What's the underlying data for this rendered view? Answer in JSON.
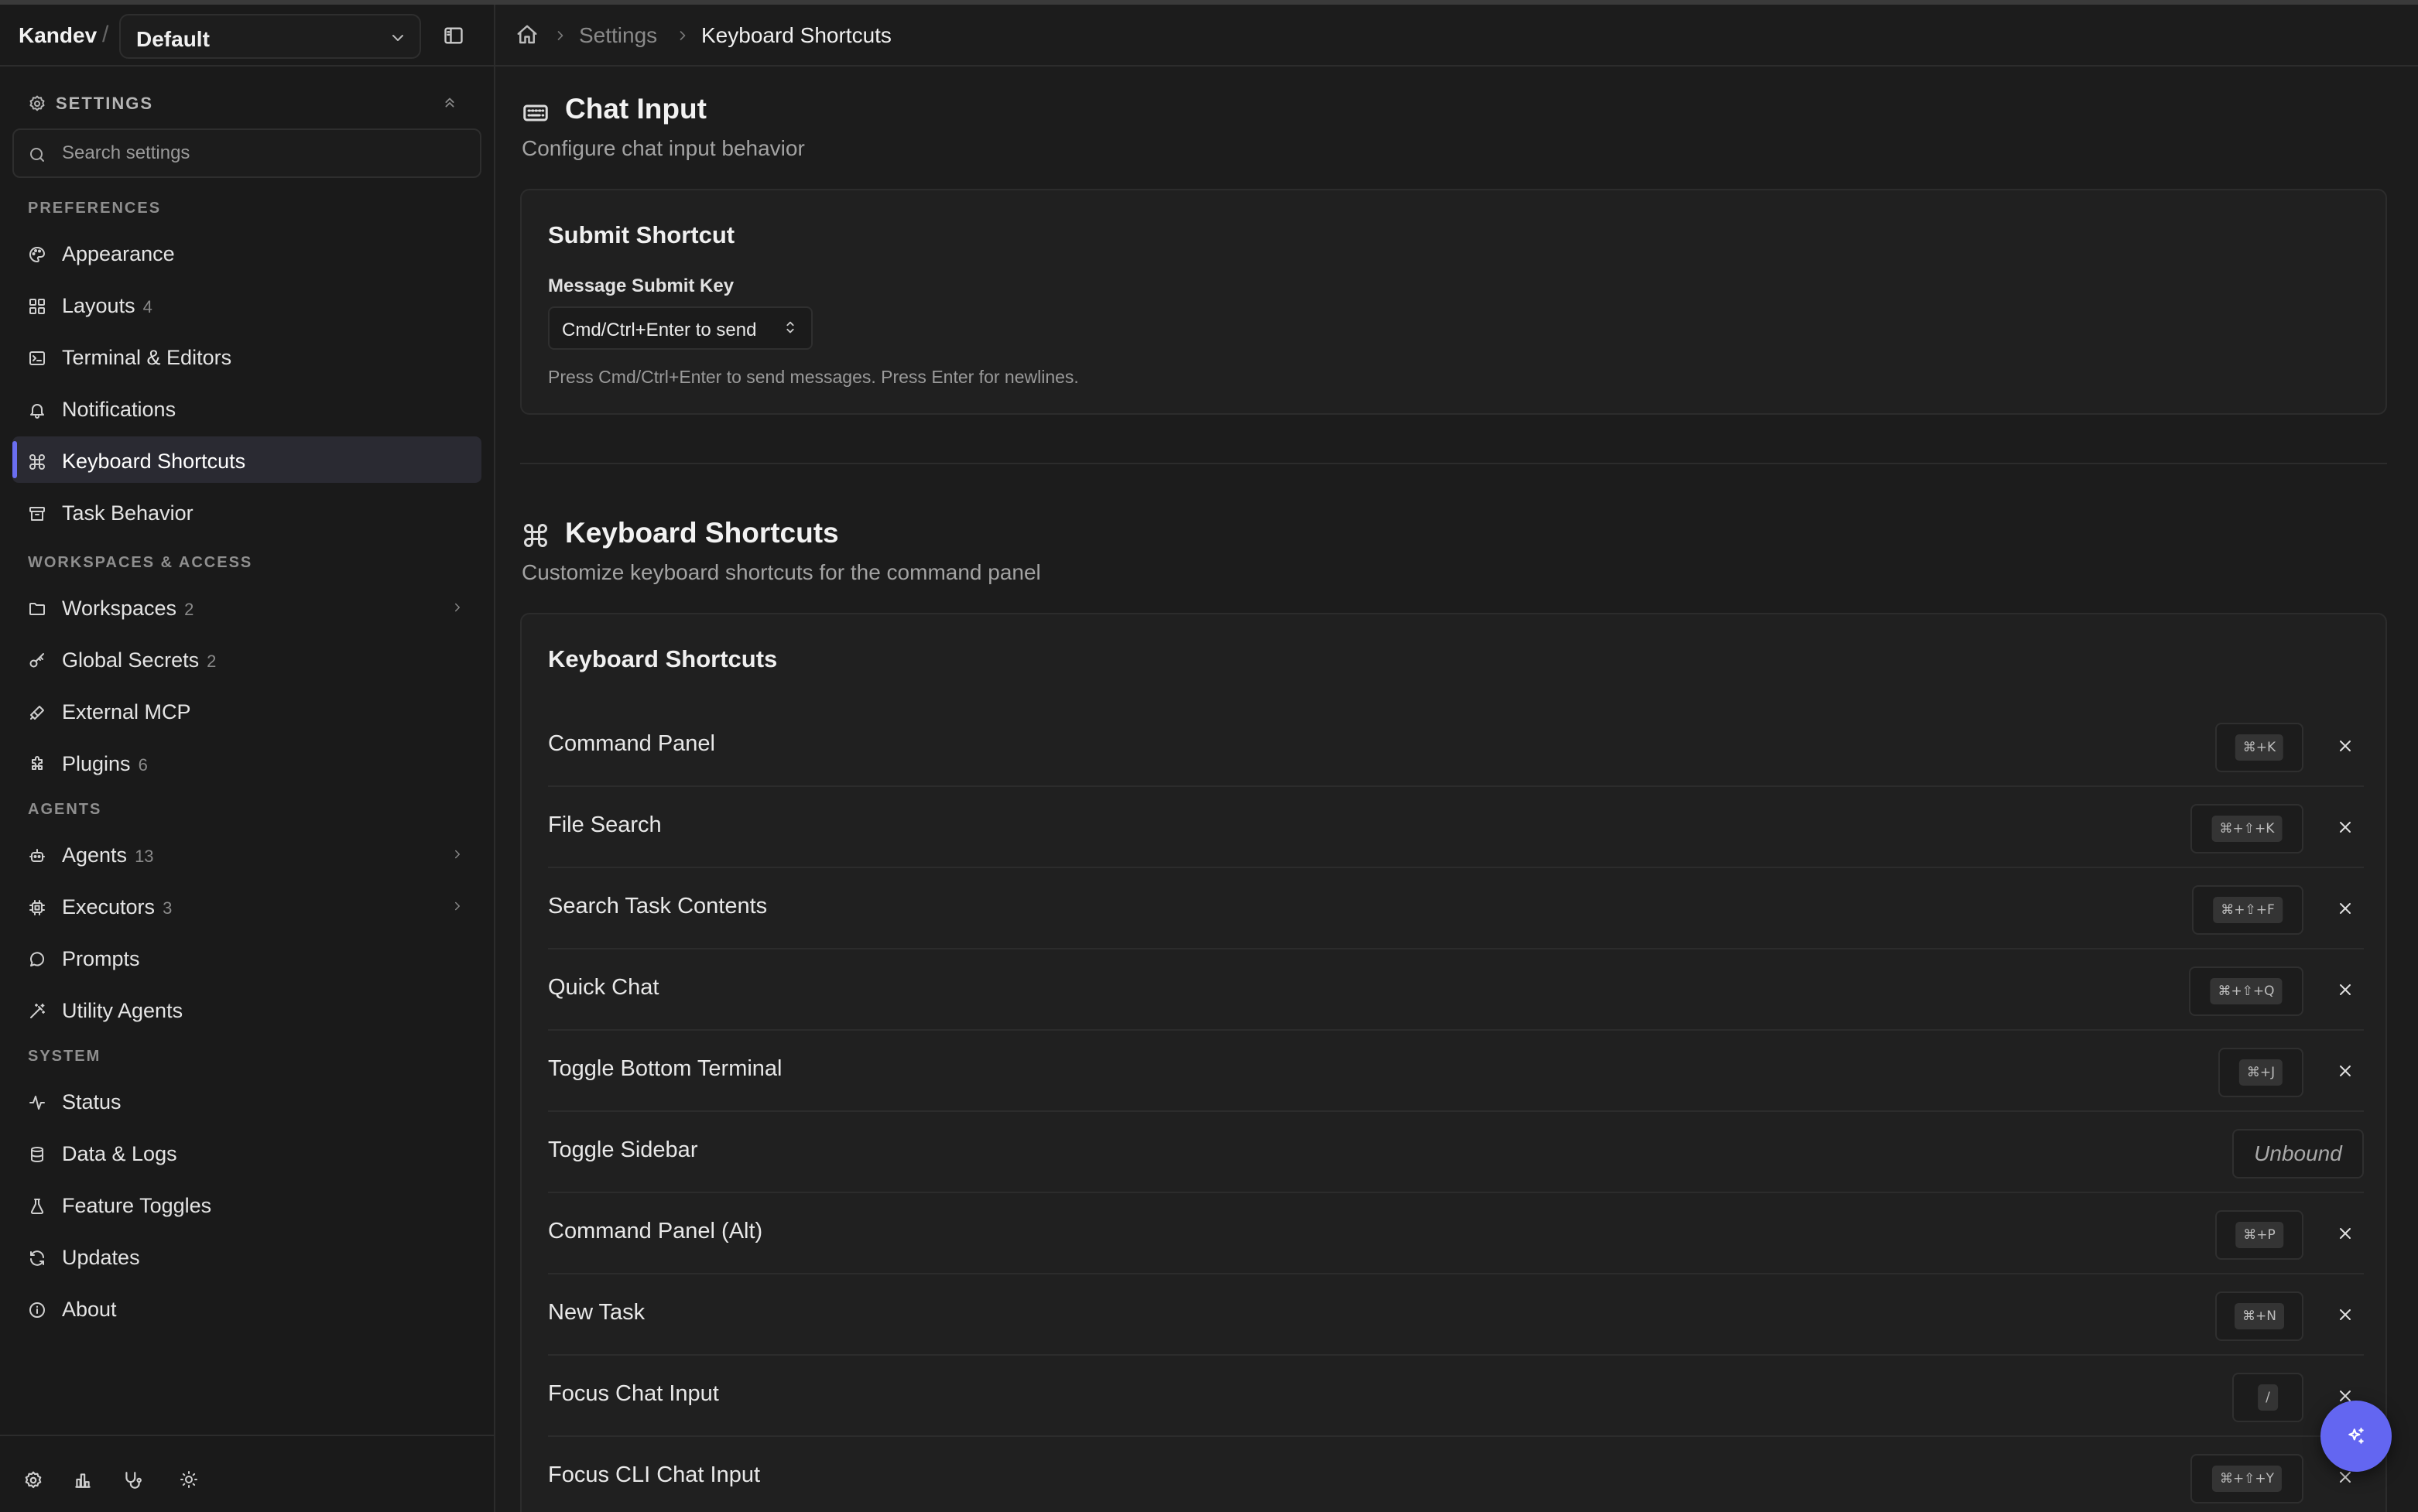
{
  "header": {
    "brand": "Kandev",
    "slash": "/",
    "workspace": "Default"
  },
  "sidebar": {
    "section_title": "SETTINGS",
    "search_placeholder": "Search settings",
    "groups": {
      "preferences": "PREFERENCES",
      "workspaces": "WORKSPACES & ACCESS",
      "agents": "AGENTS",
      "system": "SYSTEM"
    },
    "items": [
      {
        "label": "Appearance",
        "count": "",
        "icon": "palette-icon"
      },
      {
        "label": "Layouts",
        "count": "4",
        "icon": "layout-grid-icon"
      },
      {
        "label": "Terminal & Editors",
        "count": "",
        "icon": "terminal-icon"
      },
      {
        "label": "Notifications",
        "count": "",
        "icon": "bell-icon"
      },
      {
        "label": "Keyboard Shortcuts",
        "count": "",
        "icon": "command-icon",
        "active": true
      },
      {
        "label": "Task Behavior",
        "count": "",
        "icon": "archive-icon"
      },
      {
        "label": "Workspaces",
        "count": "2",
        "icon": "folder-icon"
      },
      {
        "label": "Global Secrets",
        "count": "2",
        "icon": "key-icon"
      },
      {
        "label": "External MCP",
        "count": "",
        "icon": "plug-icon"
      },
      {
        "label": "Plugins",
        "count": "6",
        "icon": "puzzle-icon"
      },
      {
        "label": "Agents",
        "count": "13",
        "icon": "bot-icon"
      },
      {
        "label": "Executors",
        "count": "3",
        "icon": "cpu-icon"
      },
      {
        "label": "Prompts",
        "count": "",
        "icon": "message-circle-icon"
      },
      {
        "label": "Utility Agents",
        "count": "",
        "icon": "wand-icon"
      },
      {
        "label": "Status",
        "count": "",
        "icon": "activity-icon"
      },
      {
        "label": "Data & Logs",
        "count": "",
        "icon": "database-icon"
      },
      {
        "label": "Feature Toggles",
        "count": "",
        "icon": "flask-icon"
      },
      {
        "label": "Updates",
        "count": "",
        "icon": "refresh-icon"
      },
      {
        "label": "About",
        "count": "",
        "icon": "info-icon"
      }
    ]
  },
  "breadcrumb": {
    "home_icon": "home-icon",
    "items": [
      "Settings",
      "Keyboard Shortcuts"
    ]
  },
  "chat_input": {
    "title": "Chat Input",
    "description": "Configure chat input behavior",
    "card_title": "Submit Shortcut",
    "field_label": "Message Submit Key",
    "select_value": "Cmd/Ctrl+Enter to send",
    "hint": "Press Cmd/Ctrl+Enter to send messages. Press Enter for newlines."
  },
  "shortcuts": {
    "title": "Keyboard Shortcuts",
    "description": "Customize keyboard shortcuts for the command panel",
    "card_title": "Keyboard Shortcuts",
    "rows": [
      {
        "label": "Command Panel",
        "key": "⌘+K"
      },
      {
        "label": "File Search",
        "key": "⌘+⇧+K"
      },
      {
        "label": "Search Task Contents",
        "key": "⌘+⇧+F"
      },
      {
        "label": "Quick Chat",
        "key": "⌘+⇧+Q"
      },
      {
        "label": "Toggle Bottom Terminal",
        "key": "⌘+J"
      },
      {
        "label": "Toggle Sidebar",
        "key": "Unbound"
      },
      {
        "label": "Command Panel (Alt)",
        "key": "⌘+P"
      },
      {
        "label": "New Task",
        "key": "⌘+N"
      },
      {
        "label": "Focus Chat Input",
        "key": "/"
      },
      {
        "label": "Focus CLI Chat Input",
        "key": "⌘+⇧+Y"
      }
    ]
  },
  "colors": {
    "accent": "#6366f1",
    "background": "#1c1c1c",
    "sidebar_bg": "#1a1a1a"
  }
}
